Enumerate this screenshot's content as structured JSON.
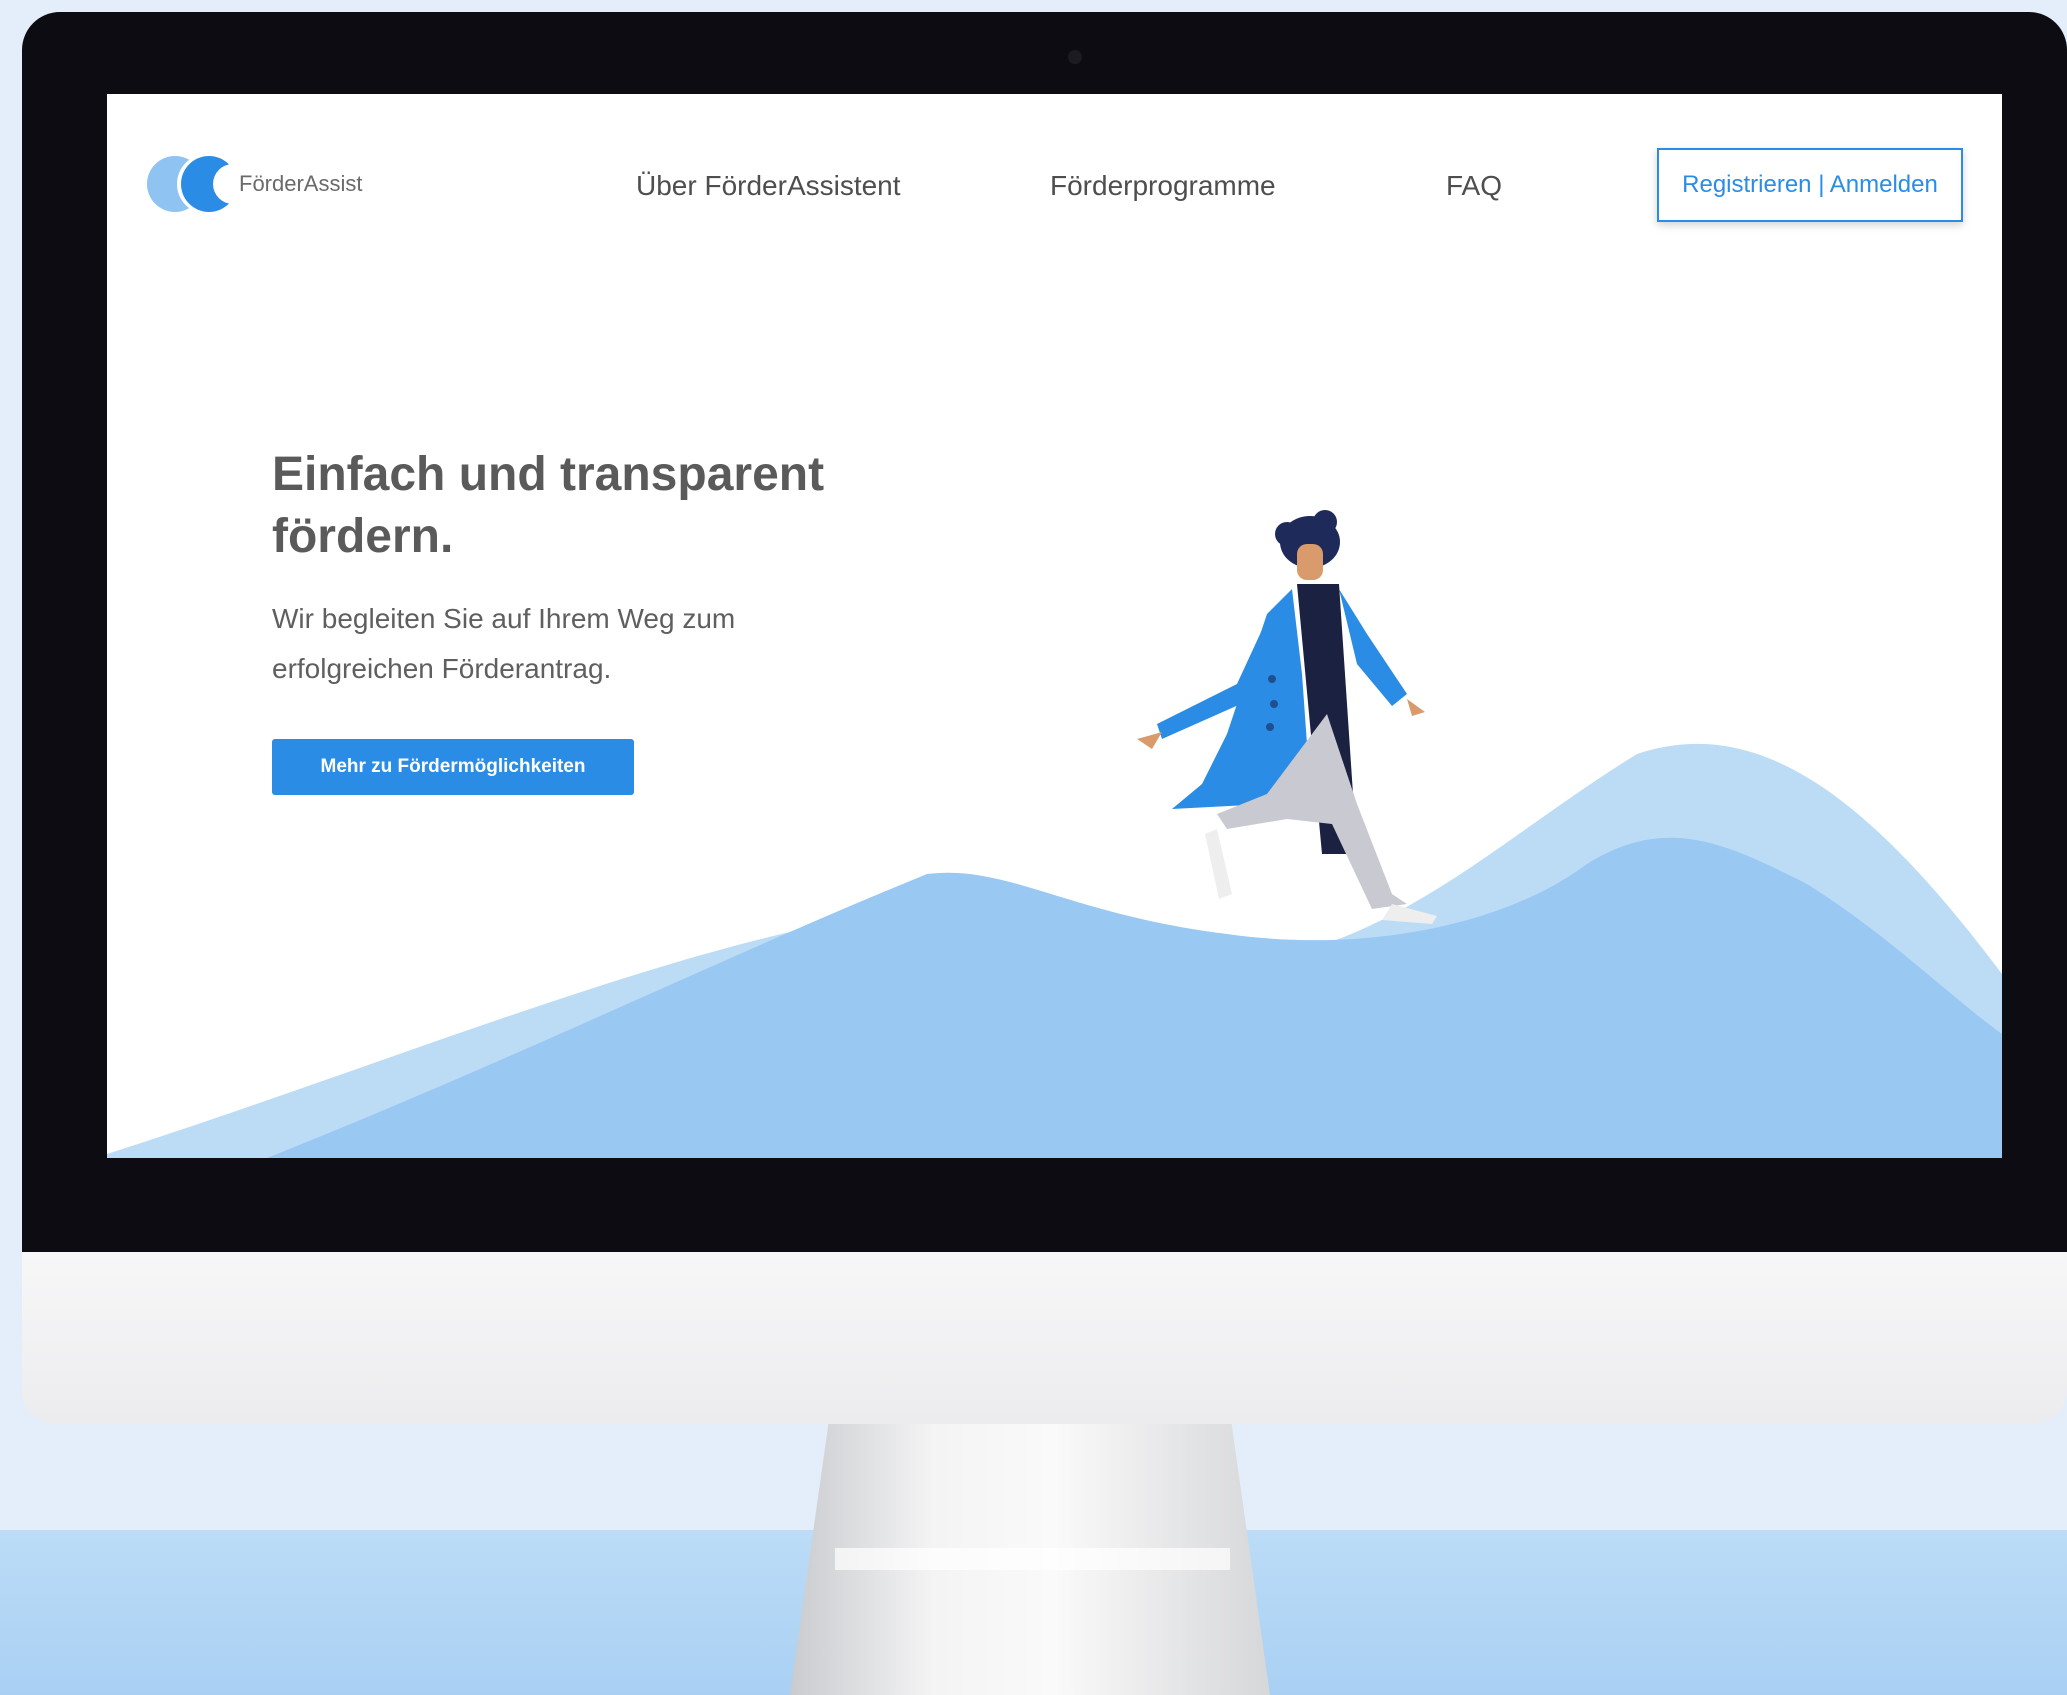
{
  "logo": {
    "text": "FörderAssist"
  },
  "nav": {
    "items": [
      {
        "label": "Über FörderAssistent"
      },
      {
        "label": "Förderprogramme"
      },
      {
        "label": "FAQ"
      }
    ],
    "auth_label": "Registrieren | Anmelden"
  },
  "hero": {
    "title": "Einfach und transparent fördern.",
    "subtitle": "Wir begleiten Sie auf Ihrem Weg zum erfolgreichen Förderantrag.",
    "cta_label": "Mehr zu Fördermöglichkeiten"
  },
  "colors": {
    "accent": "#2b8ce6",
    "hill_light": "#bcdcf6",
    "hill_mid": "#99c8f3",
    "bezel": "#0d0c12"
  }
}
